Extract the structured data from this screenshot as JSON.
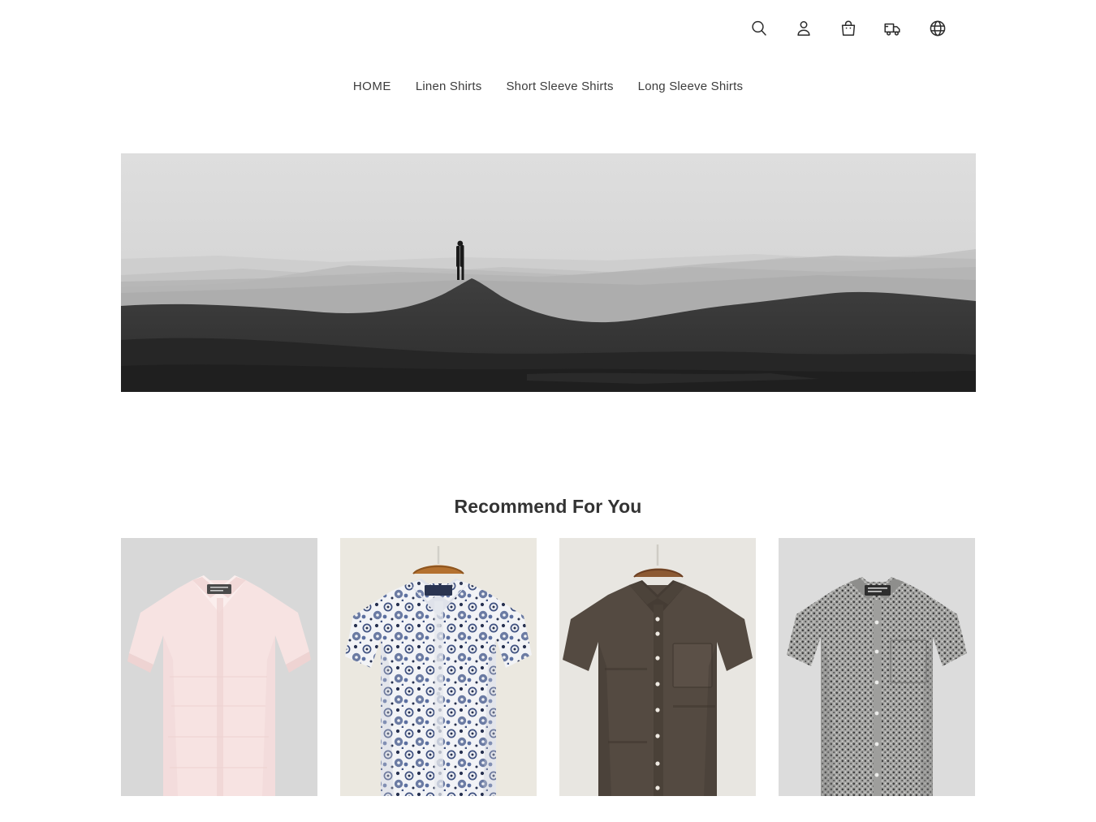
{
  "header": {
    "icons": [
      {
        "name": "search-icon",
        "label": "Search"
      },
      {
        "name": "account-icon",
        "label": "Account"
      },
      {
        "name": "cart-icon",
        "label": "Cart"
      },
      {
        "name": "shipping-truck-icon",
        "label": "Track Order"
      },
      {
        "name": "globe-language-icon",
        "label": "Language"
      }
    ]
  },
  "nav": {
    "items": [
      {
        "label": "HOME"
      },
      {
        "label": "Linen Shirts"
      },
      {
        "label": "Short Sleeve Shirts"
      },
      {
        "label": "Long Sleeve Shirts"
      }
    ]
  },
  "hero": {
    "alt": "Grayscale desert dunes with a person silhouetted on the ridge",
    "sky_color": "#d9d9d9",
    "far_ridge_color": "#c2c2c2",
    "mid_ridge_color": "#a8a8a8",
    "dune_color": "#3a3a3a",
    "foreground_color": "#2a2a2a"
  },
  "recommend": {
    "title": "Recommend For You",
    "products": [
      {
        "name": "pink-short-sleeve-shirt",
        "alt": "Pale pink short sleeve shirt",
        "background": "#d8d8d8",
        "shirt_color": "#f7e3e2",
        "shirt_shadow": "#eed3d2",
        "label_color": "#4a4a4a"
      },
      {
        "name": "blue-floral-print-shirt",
        "alt": "White shirt with blue floral paisley print on wooden hanger",
        "background": "#ebe8e0",
        "shirt_color": "#f2f3f6",
        "shirt_shadow": "#dcdde4",
        "print_color": "#3f5180",
        "print_color_dark": "#26304f",
        "hanger_color": "#b4712f"
      },
      {
        "name": "brown-linen-shirt",
        "alt": "Dark brown linen short sleeve shirt on hanger",
        "background": "#e8e6e1",
        "shirt_color": "#544a41",
        "shirt_shadow": "#3c342d",
        "button_color": "#efeae2",
        "hanger_color": "#8c5a33"
      },
      {
        "name": "gray-micro-print-shirt",
        "alt": "Gray and black micro print short sleeve shirt",
        "background": "#dcdcdc",
        "shirt_color": "#9a9a98",
        "shirt_shadow": "#7e7e7d",
        "print_color": "#3a3a3a",
        "label_color": "#2e2e2e"
      }
    ]
  }
}
